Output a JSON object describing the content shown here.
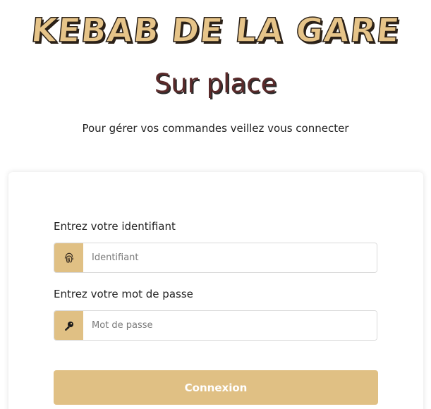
{
  "header": {
    "brand_title": "KEBAB DE LA GARE",
    "subtitle": "Sur place",
    "intro_text": "Pour gérer vos commandes veillez vous connecter"
  },
  "login_form": {
    "username_label": "Entrez votre identifiant",
    "username_placeholder": "Identifiant",
    "username_icon": "fingerprint-icon",
    "password_label": "Entrez votre mot de passe",
    "password_placeholder": "Mot de passe",
    "password_icon": "key-icon",
    "submit_label": "Connexion"
  },
  "colors": {
    "accent": "#e0c084",
    "title_fill": "#e6c489",
    "subtitle": "#5a2a2a",
    "text": "#222222"
  }
}
